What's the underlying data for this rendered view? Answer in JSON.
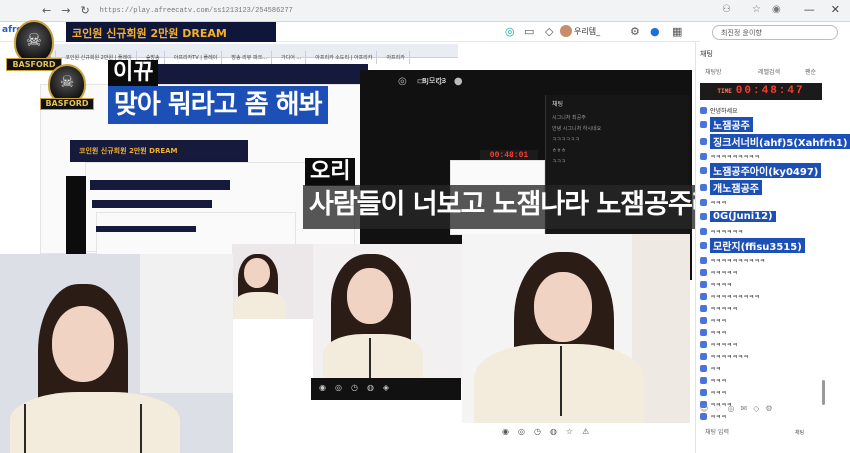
{
  "browser": {
    "url": "https://play.afreecatv.com/ss1213123/254586277",
    "nav_icons": [
      "back-arrow",
      "forward-arrow",
      "reload"
    ],
    "window_buttons": [
      "minimize",
      "maximize",
      "close"
    ]
  },
  "site": {
    "logo": "afree",
    "stream_title": "코인원 신규회원 2만원 DREAM",
    "username": "우리템_",
    "search_placeholder": "최진정 윤이향",
    "nested_title": "코인원 신규회원 2만원 DREAM",
    "inner_username": "BJ모리3",
    "tabs": [
      "ㅋㅋ",
      "코인원 신규회원 2만원 | 플레이",
      "숲방송",
      "아프리카TV | 플레이",
      "방송 리뷰 파크...",
      "가디어 ...",
      "아프리카 소도리 | 아프리카",
      "아프리카"
    ]
  },
  "colors": {
    "caption_blue": "#1d50b7",
    "title_gold": "#f2b12c",
    "timer_red": "#ff3b2f"
  },
  "emblem": {
    "text": "BASFORD"
  },
  "captions": {
    "speaker1": "이뀨",
    "line1": "맞아 뭐라고 좀 해봐",
    "speaker2": "오리",
    "line2": "사람들이 너보고 노잼나라 노잼공주래"
  },
  "timers": {
    "main_label": "TIME",
    "main": "00:48:47",
    "small": "00:48:01"
  },
  "dark_panel": {
    "chat_title": "채팅",
    "chat_lines": [
      "시그니처 최공주",
      "안녕 시그니처 하시네요",
      "ㅋㅋㅋㅋㅋㅋ",
      "ㅎㅎㅎ",
      "ㅋㅋㅋ"
    ]
  },
  "chat": {
    "title": "채팅",
    "tab1": "채팅방",
    "tab2": "레벨검색",
    "tab3": "팬순",
    "rows": [
      {
        "nick": "",
        "msg": "안녕하세요",
        "big": false
      },
      {
        "nick": "",
        "msg": "노잼공주",
        "big": true
      },
      {
        "nick": "",
        "msg": "징크서너비(ahf)5(Xahfrh1)",
        "big": true
      },
      {
        "nick": "",
        "msg": "ㅋㅋㅋㅋㅋㅋㅋㅋㅋ",
        "big": false
      },
      {
        "nick": "",
        "msg": "노잼공주아이(ky0497)",
        "big": true
      },
      {
        "nick": "",
        "msg": "개노잼공주",
        "big": true
      },
      {
        "nick": "",
        "msg": "ㅋㅋㅋ",
        "big": false
      },
      {
        "nick": "",
        "msg": "0G(Juni12)",
        "big": true
      },
      {
        "nick": "",
        "msg": "ㅋㅋㅋㅋㅋㅋ",
        "big": false
      },
      {
        "nick": "",
        "msg": "모란지(ffisu3515)",
        "big": true
      },
      {
        "nick": "",
        "msg": "ㅋㅋㅋㅋㅋㅋㅋㅋㅋㅋ",
        "big": false
      },
      {
        "nick": "",
        "msg": "ㅋㅋㅋㅋㅋ",
        "big": false
      },
      {
        "nick": "",
        "msg": "ㅋㅋㅋㅋ",
        "big": false
      },
      {
        "nick": "",
        "msg": "ㅋㅋㅋㅋㅋㅋㅋㅋㅋ",
        "big": false
      },
      {
        "nick": "",
        "msg": "ㅋㅋㅋㅋㅋ",
        "big": false
      },
      {
        "nick": "",
        "msg": "ㅋㅋㅋ",
        "big": false
      },
      {
        "nick": "",
        "msg": "ㅋㅋㅋ",
        "big": false
      },
      {
        "nick": "",
        "msg": "ㅋㅋㅋㅋㅋ",
        "big": false
      },
      {
        "nick": "",
        "msg": "ㅋㅋㅋㅋㅋㅋㅋ",
        "big": false
      },
      {
        "nick": "",
        "msg": "ㅋㅋ",
        "big": false
      },
      {
        "nick": "",
        "msg": "ㅋㅋㅋ",
        "big": false
      },
      {
        "nick": "",
        "msg": "ㅋㅋㅋ",
        "big": false
      },
      {
        "nick": "",
        "msg": "ㅋㅋㅋㅋ",
        "big": false
      },
      {
        "nick": "",
        "msg": "ㅋㅋㅋ",
        "big": false
      }
    ],
    "input_placeholder": "채팅 입력",
    "send": "채팅"
  }
}
